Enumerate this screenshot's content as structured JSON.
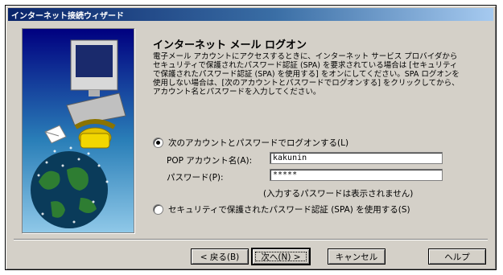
{
  "window": {
    "title": "インターネット接続ウィザード"
  },
  "page": {
    "heading": "インターネット メール ログオン",
    "description": "電子メール アカウントにアクセスするときに、インターネット サービス プロバイダからセキュリティで保護されたパスワード認証 (SPA) を要求されている場合は [セキュリティで保護されたパスワード認証 (SPA) を使用する] をオンにしてください。SPA ログオンを使用しない場合は、[次のアカウントとパスワードでログオンする] をクリックしてから、アカウント名とパスワードを入力してください。"
  },
  "logon_options": {
    "option_account": {
      "label": "次のアカウントとパスワードでログオンする(L)",
      "selected": true
    },
    "account_name_label": "POP アカウント名(A):",
    "account_name_value": "kakunin",
    "password_label": "パスワード(P):",
    "password_value": "*****",
    "password_note": "(入力するパスワードは表示されません)",
    "option_spa": {
      "label": "セキュリティで保護されたパスワード認証 (SPA) を使用する(S)",
      "selected": false
    }
  },
  "buttons": {
    "back": "< 戻る(B)",
    "next": "次へ(N) >",
    "cancel": "キャンセル",
    "help": "ヘルプ"
  },
  "colors": {
    "dialog_face": "#d4d0c8",
    "title_bar": "#0a246a"
  }
}
